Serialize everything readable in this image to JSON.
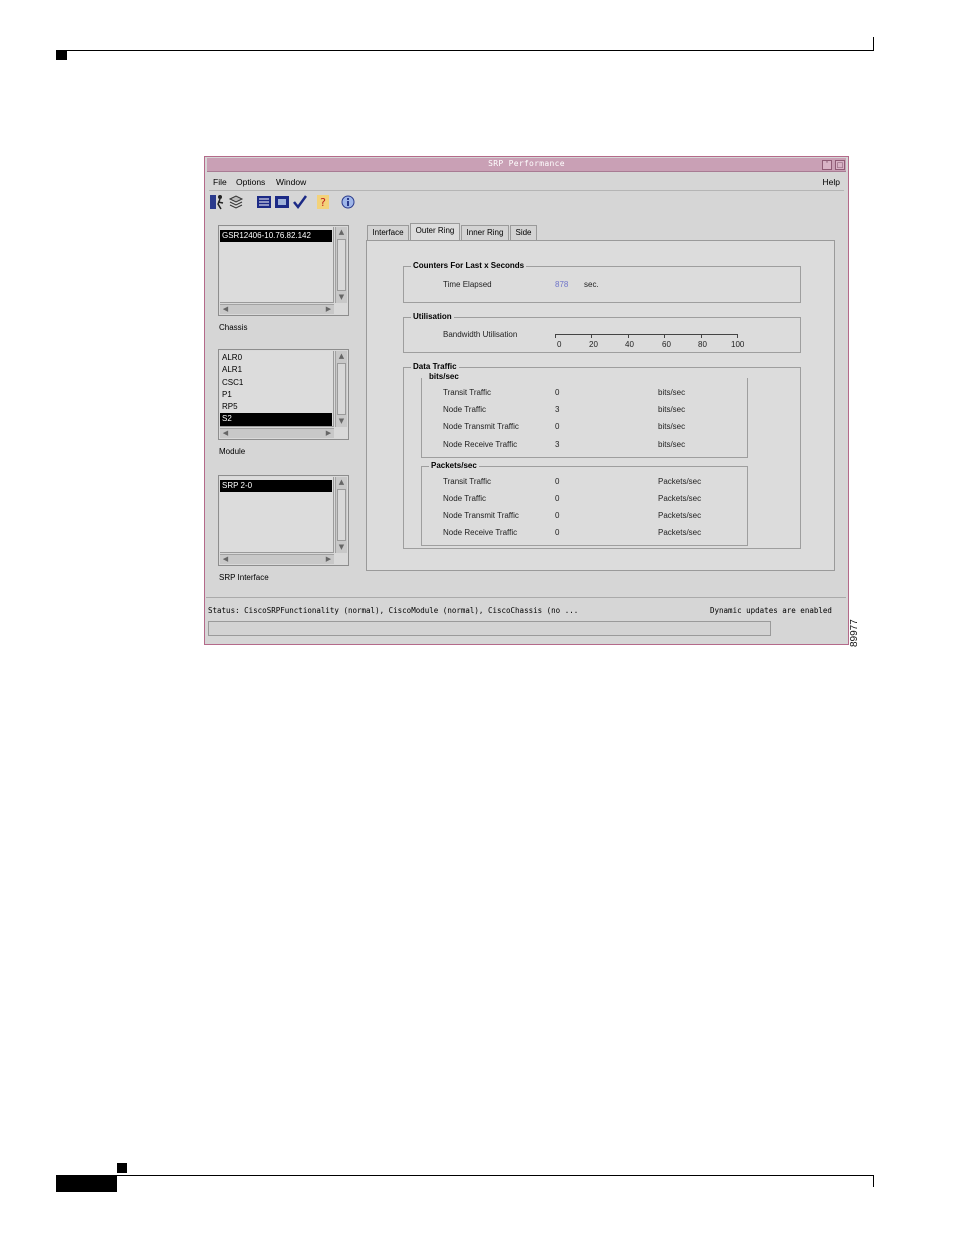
{
  "window": {
    "title": "SRP Performance",
    "menus": [
      "File",
      "Options",
      "Window"
    ],
    "help": "Help"
  },
  "toolbar": {
    "icons": [
      "exit-icon",
      "layers-icon",
      "list-icon",
      "window-icon",
      "check-icon",
      "help-icon",
      "info-icon"
    ]
  },
  "chassis": {
    "label": "Chassis",
    "items": [
      "GSR12406-10.76.82.142"
    ],
    "selected_index": 0
  },
  "module": {
    "label": "Module",
    "items": [
      "ALR0",
      "ALR1",
      "CSC1",
      "P1",
      "RP5",
      "S2"
    ],
    "selected_index": 5
  },
  "srp_interface": {
    "label": "SRP Interface",
    "items": [
      "SRP 2-0"
    ],
    "selected_index": 0
  },
  "tabs": [
    "Interface",
    "Outer Ring",
    "Inner Ring",
    "Side"
  ],
  "active_tab": "Outer Ring",
  "counters": {
    "legend": "Counters For Last x Seconds",
    "time_elapsed_label": "Time Elapsed",
    "time_elapsed_value": "878",
    "time_elapsed_unit": "sec."
  },
  "utilisation": {
    "legend": "Utilisation",
    "bandwidth_label": "Bandwidth Utilisation",
    "scale_labels": [
      "0",
      "20",
      "40",
      "60",
      "80",
      "100"
    ],
    "value_percent": 0
  },
  "data_traffic": {
    "legend": "Data Traffic",
    "bits": {
      "legend": "bits/sec",
      "rows": [
        {
          "label": "Transit Traffic",
          "value": "0",
          "unit": "bits/sec"
        },
        {
          "label": "Node Traffic",
          "value": "3",
          "unit": "bits/sec"
        },
        {
          "label": "Node Transmit Traffic",
          "value": "0",
          "unit": "bits/sec"
        },
        {
          "label": "Node Receive Traffic",
          "value": "3",
          "unit": "bits/sec"
        }
      ]
    },
    "packets": {
      "legend": "Packets/sec",
      "rows": [
        {
          "label": "Transit Traffic",
          "value": "0",
          "unit": "Packets/sec"
        },
        {
          "label": "Node Traffic",
          "value": "0",
          "unit": "Packets/sec"
        },
        {
          "label": "Node Transmit Traffic",
          "value": "0",
          "unit": "Packets/sec"
        },
        {
          "label": "Node Receive Traffic",
          "value": "0",
          "unit": "Packets/sec"
        }
      ]
    }
  },
  "status": {
    "text": "Status: CiscoSRPFunctionality (normal), CiscoModule (normal), CiscoChassis (no ...",
    "updates": "Dynamic updates are enabled"
  },
  "figure_number": "89977",
  "colors": {
    "titlebar": "#c9a0b5",
    "window_bg": "#d6d6d6",
    "accent_value": "#6f74c9",
    "selection": "#000000"
  }
}
